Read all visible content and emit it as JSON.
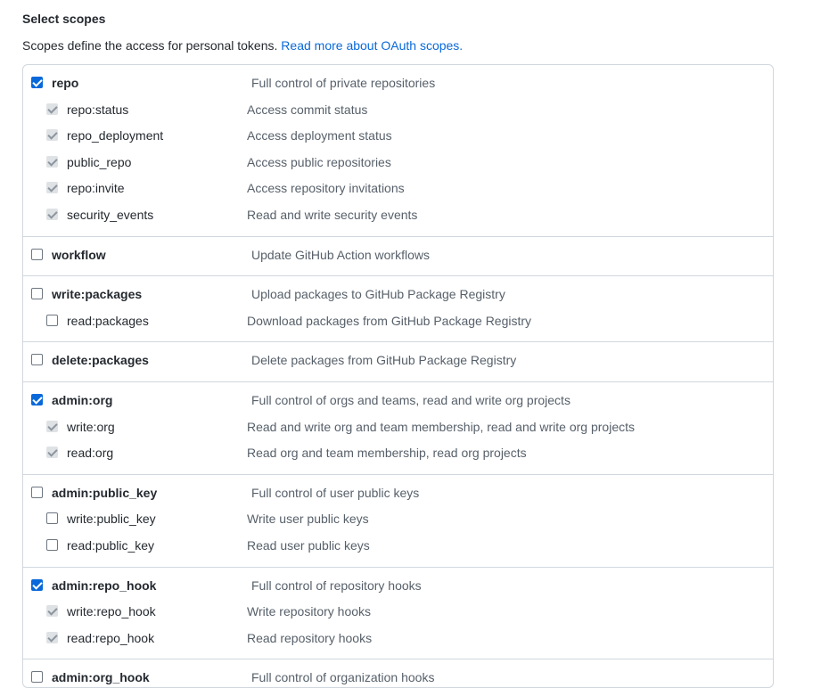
{
  "header": {
    "title": "Select scopes",
    "note_text": "Scopes define the access for personal tokens.",
    "note_link": "Read more about OAuth scopes."
  },
  "scope_groups": [
    {
      "parent": {
        "name": "repo",
        "description": "Full control of private repositories",
        "checked": true
      },
      "children": [
        {
          "name": "repo:status",
          "description": "Access commit status",
          "state": "disabled-checked"
        },
        {
          "name": "repo_deployment",
          "description": "Access deployment status",
          "state": "disabled-checked"
        },
        {
          "name": "public_repo",
          "description": "Access public repositories",
          "state": "disabled-checked"
        },
        {
          "name": "repo:invite",
          "description": "Access repository invitations",
          "state": "disabled-checked"
        },
        {
          "name": "security_events",
          "description": "Read and write security events",
          "state": "disabled-checked"
        }
      ]
    },
    {
      "parent": {
        "name": "workflow",
        "description": "Update GitHub Action workflows",
        "checked": false
      },
      "children": []
    },
    {
      "parent": {
        "name": "write:packages",
        "description": "Upload packages to GitHub Package Registry",
        "checked": false
      },
      "children": [
        {
          "name": "read:packages",
          "description": "Download packages from GitHub Package Registry",
          "state": "unchecked"
        }
      ]
    },
    {
      "parent": {
        "name": "delete:packages",
        "description": "Delete packages from GitHub Package Registry",
        "checked": false
      },
      "children": []
    },
    {
      "parent": {
        "name": "admin:org",
        "description": "Full control of orgs and teams, read and write org projects",
        "checked": true
      },
      "children": [
        {
          "name": "write:org",
          "description": "Read and write org and team membership, read and write org projects",
          "state": "disabled-checked"
        },
        {
          "name": "read:org",
          "description": "Read org and team membership, read org projects",
          "state": "disabled-checked"
        }
      ]
    },
    {
      "parent": {
        "name": "admin:public_key",
        "description": "Full control of user public keys",
        "checked": false
      },
      "children": [
        {
          "name": "write:public_key",
          "description": "Write user public keys",
          "state": "unchecked"
        },
        {
          "name": "read:public_key",
          "description": "Read user public keys",
          "state": "unchecked"
        }
      ]
    },
    {
      "parent": {
        "name": "admin:repo_hook",
        "description": "Full control of repository hooks",
        "checked": true
      },
      "children": [
        {
          "name": "write:repo_hook",
          "description": "Write repository hooks",
          "state": "disabled-checked"
        },
        {
          "name": "read:repo_hook",
          "description": "Read repository hooks",
          "state": "disabled-checked"
        }
      ]
    },
    {
      "parent": {
        "name": "admin:org_hook",
        "description": "Full control of organization hooks",
        "checked": false
      },
      "children": []
    }
  ],
  "colors": {
    "link": "#0969da",
    "checkbox_checked": "#0969da",
    "checkbox_disabled": "#dfe2e5",
    "border": "#d0d7de",
    "description_text": "#57606a"
  }
}
